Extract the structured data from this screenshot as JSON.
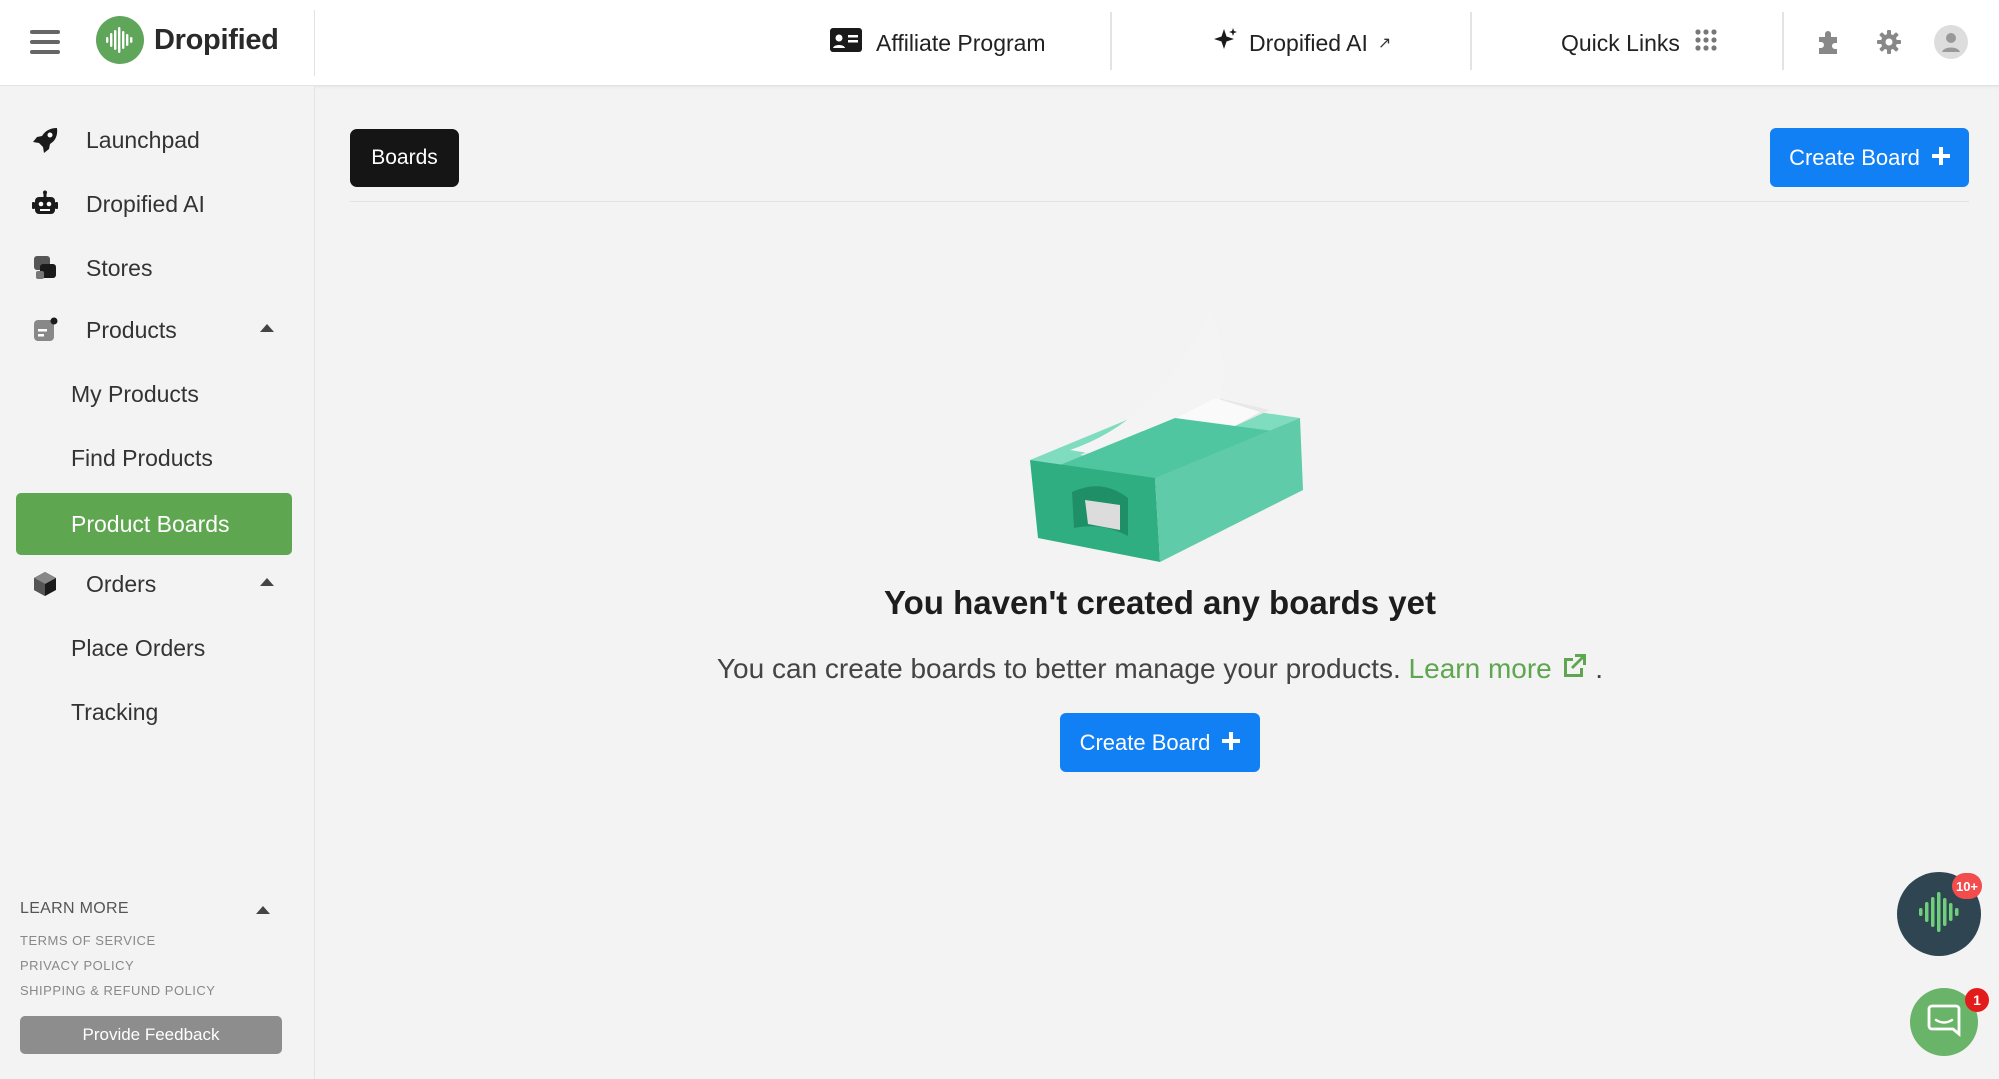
{
  "header": {
    "brand": "Dropified",
    "affiliate_label": "Affiliate Program",
    "ai_label": "Dropified AI",
    "ai_arrow": "↗",
    "quick_links_label": "Quick Links"
  },
  "sidebar": {
    "items": [
      {
        "label": "Launchpad"
      },
      {
        "label": "Dropified AI"
      },
      {
        "label": "Stores"
      },
      {
        "label": "Products"
      },
      {
        "label": "My Products"
      },
      {
        "label": "Find Products"
      },
      {
        "label": "Product Boards"
      },
      {
        "label": "Orders"
      },
      {
        "label": "Place Orders"
      },
      {
        "label": "Tracking"
      }
    ],
    "learn_more": "LEARN MORE",
    "footer_links": [
      "TERMS OF SERVICE",
      "PRIVACY POLICY",
      "SHIPPING & REFUND POLICY"
    ],
    "feedback_label": "Provide Feedback"
  },
  "main": {
    "tab_label": "Boards",
    "create_label": "Create Board",
    "empty_title": "You haven't created any boards yet",
    "empty_desc": "You can create boards to better manage your products.",
    "learn_more_link": "Learn more",
    "desc_suffix": "."
  },
  "floating": {
    "badge_dark": "10+",
    "badge_green": "1"
  },
  "colors": {
    "accent_green": "#5ea64f",
    "primary_blue": "#1180f5",
    "dark": "#151515"
  }
}
